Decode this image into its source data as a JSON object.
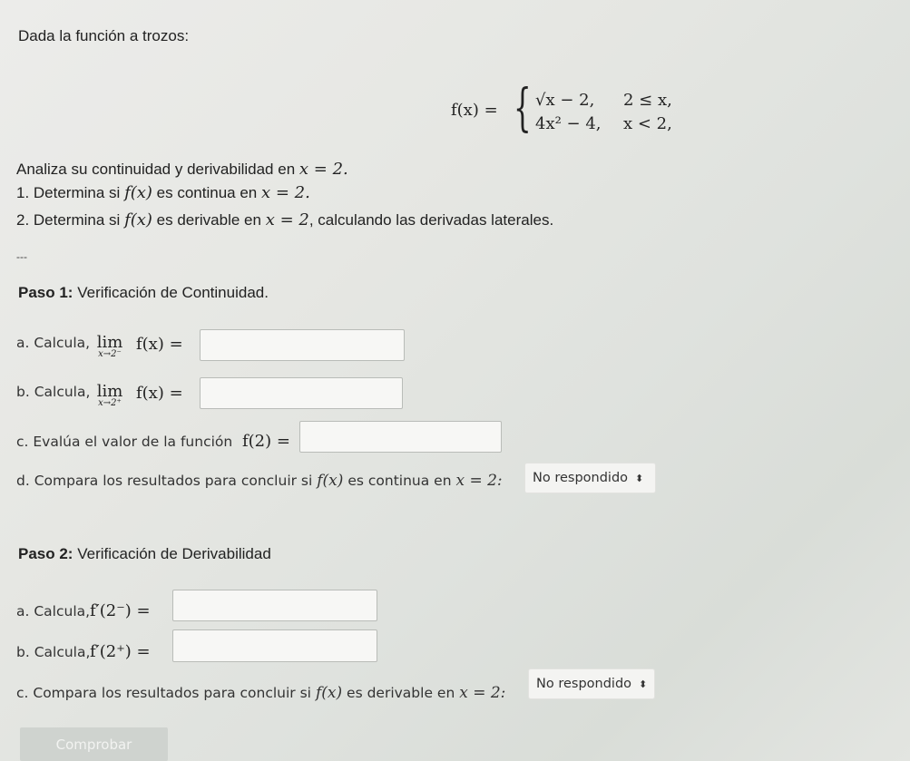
{
  "intro": "Dada la función a trozos:",
  "function_def": {
    "lhs": "f(x) =",
    "case1_expr": "√x − 2,",
    "case1_cond": "2 ≤ x,",
    "case2_expr": "4x² − 4,",
    "case2_cond": "x < 2,"
  },
  "task": {
    "text": "Analiza su continuidad y derivabilidad en",
    "math": "x = 2."
  },
  "items": [
    {
      "prefix": "1. Determina si",
      "math1": "f(x)",
      "mid": "es continua en",
      "math2": "x = 2.",
      "suffix": ""
    },
    {
      "prefix": "2. Determina si",
      "math1": "f(x)",
      "mid": "es derivable en",
      "math2": "x = 2",
      "suffix": ", calculando las derivadas laterales."
    }
  ],
  "separator": "---",
  "step1": {
    "title_bold": "Paso 1:",
    "title_rest": " Verificación de Continuidad.",
    "a_label": "a. Calcula,",
    "a_lim": "lim",
    "a_sub": "x→2⁻",
    "a_expr": "f(x) =",
    "b_label": "b. Calcula,",
    "b_lim": "lim",
    "b_sub": "x→2⁺",
    "b_expr": "f(x) =",
    "c_label": "c. Evalúa el valor de la función",
    "c_expr": "f(2) =",
    "d_label": "d. Compara los resultados para concluir si",
    "d_math1": "f(x)",
    "d_mid": "es continua en",
    "d_math2": "x = 2:",
    "d_select": "No respondido"
  },
  "step2": {
    "title_bold": "Paso 2:",
    "title_rest": " Verificación de Derivabilidad",
    "a_label": "a. Calcula,",
    "a_expr": "f′(2⁻) =",
    "b_label": "b. Calcula,",
    "b_expr": "f′(2⁺) =",
    "c_label": "c. Compara los resultados para concluir si",
    "c_math1": "f(x)",
    "c_mid": "es derivable en",
    "c_math2": "x = 2:",
    "c_select": "No respondido"
  },
  "submit_label": "Comprobar"
}
